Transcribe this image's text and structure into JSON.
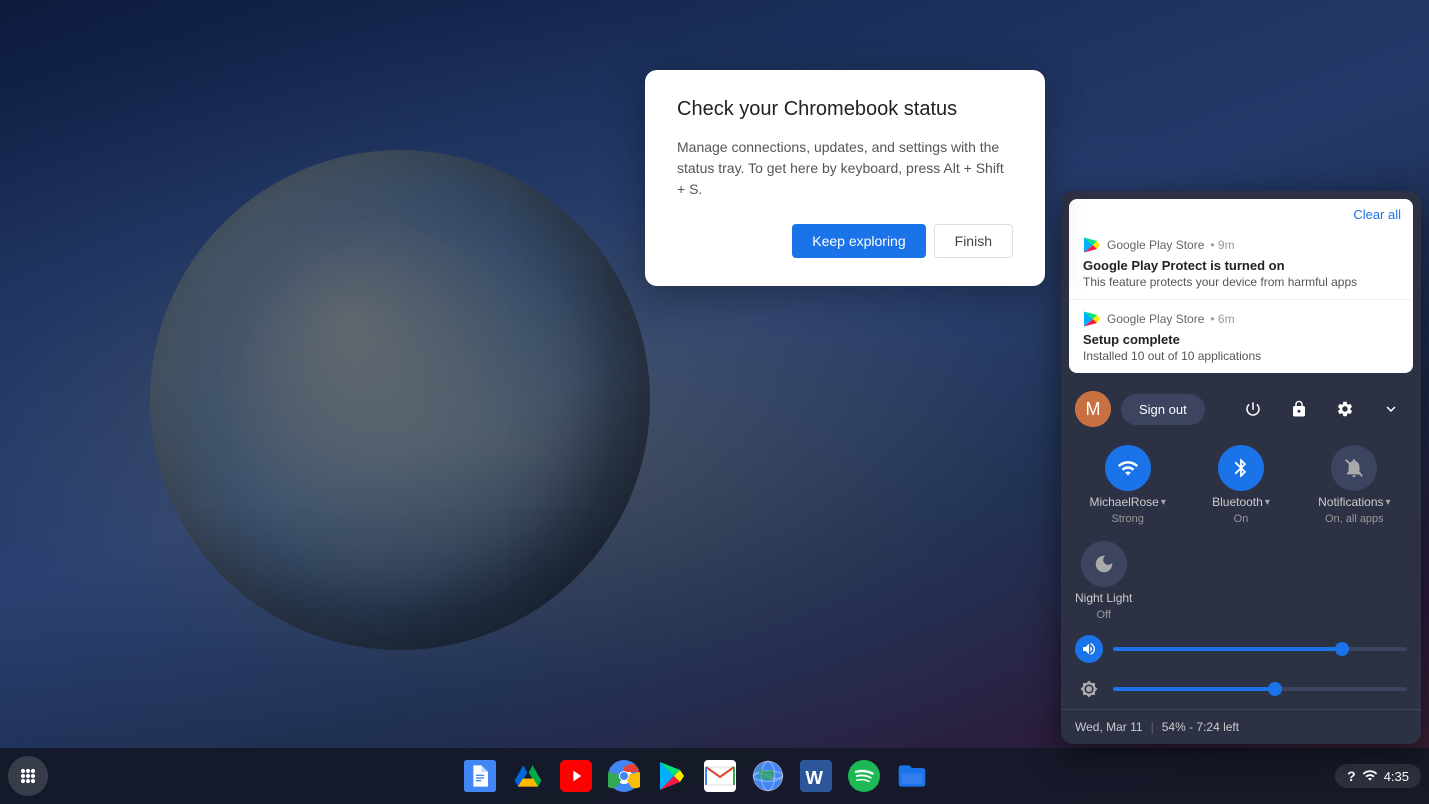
{
  "desktop": {
    "background": "dark blue gradient"
  },
  "dialog": {
    "title": "Check your Chromebook status",
    "body": "Manage connections, updates, and settings with the status tray. To get here by keyboard, press Alt + Shift + S.",
    "keep_exploring_label": "Keep exploring",
    "finish_label": "Finish"
  },
  "notifications": {
    "clear_all_label": "Clear all",
    "items": [
      {
        "source": "Google Play Store",
        "time": "9m",
        "title": "Google Play Protect is turned on",
        "body": "This feature protects your device from harmful apps"
      },
      {
        "source": "Google Play Store",
        "time": "6m",
        "title": "Setup complete",
        "body": "Installed 10 out of 10 applications"
      }
    ]
  },
  "quick_panel": {
    "sign_out_label": "Sign out",
    "toggles": [
      {
        "name": "wifi",
        "label": "MichaelRose",
        "sublabel": "Strong",
        "active": true,
        "has_arrow": true
      },
      {
        "name": "bluetooth",
        "label": "Bluetooth",
        "sublabel": "On",
        "active": true,
        "has_arrow": true
      },
      {
        "name": "notifications",
        "label": "Notifications",
        "sublabel": "On, all apps",
        "active": false,
        "has_arrow": true
      }
    ],
    "night_light": {
      "label": "Night Light",
      "sublabel": "Off",
      "active": false
    },
    "volume": {
      "percent": 78
    },
    "brightness": {
      "percent": 55
    },
    "footer": {
      "date": "Wed, Mar 11",
      "separator": "|",
      "battery": "54% - 7:24 left"
    }
  },
  "taskbar": {
    "apps": [
      {
        "name": "google-docs",
        "label": "Google Docs"
      },
      {
        "name": "google-drive",
        "label": "Google Drive"
      },
      {
        "name": "youtube",
        "label": "YouTube"
      },
      {
        "name": "chrome",
        "label": "Chrome"
      },
      {
        "name": "google-play",
        "label": "Google Play"
      },
      {
        "name": "gmail",
        "label": "Gmail"
      },
      {
        "name": "google-earth",
        "label": "Google Earth"
      },
      {
        "name": "microsoft-word",
        "label": "Microsoft Word"
      },
      {
        "name": "spotify",
        "label": "Spotify"
      },
      {
        "name": "files",
        "label": "Files"
      }
    ],
    "status": {
      "help": "?",
      "wifi": "connected",
      "time": "4:35"
    }
  }
}
